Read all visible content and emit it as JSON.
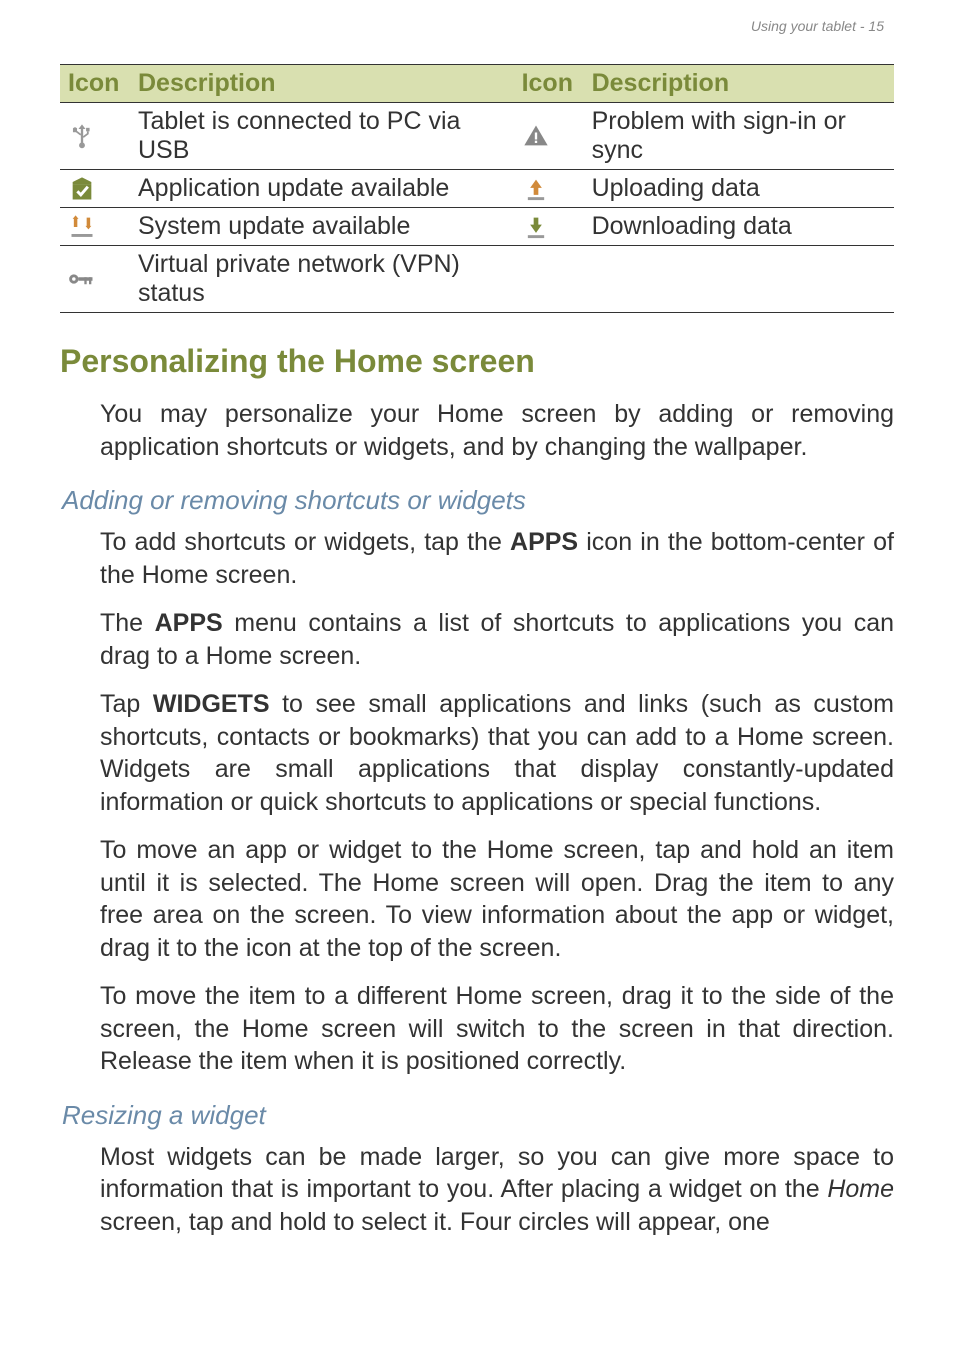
{
  "header": {
    "breadcrumb": "Using your tablet - 15"
  },
  "table": {
    "headers": {
      "icon1": "Icon",
      "desc1": "Description",
      "icon2": "Icon",
      "desc2": "Description"
    },
    "rows": [
      {
        "desc1": "Tablet is connected to PC via USB",
        "desc2": "Problem with sign-in or sync"
      },
      {
        "desc1": "Application update available",
        "desc2": "Uploading data"
      },
      {
        "desc1": "System update available",
        "desc2": "Downloading data"
      },
      {
        "desc1": "Virtual private network (VPN) status",
        "desc2": ""
      }
    ]
  },
  "section1": {
    "heading": "Personalizing the Home screen",
    "p1": "You may personalize your Home screen by adding or removing application shortcuts or widgets, and by changing the wallpaper."
  },
  "section2": {
    "heading": "Adding or removing shortcuts or widgets",
    "p1a": "To add shortcuts or widgets, tap the ",
    "p1b": "APPS",
    "p1c": " icon in the bottom-center of the Home screen.",
    "p2a": "The ",
    "p2b": "APPS",
    "p2c": " menu contains a list of shortcuts to applications you can drag to a Home screen.",
    "p3a": "Tap ",
    "p3b": "WIDGETS",
    "p3c": " to see small applications and links (such as custom shortcuts, contacts or bookmarks) that you can add to a Home screen. Widgets are small applications that display constantly-updated information or quick shortcuts to applications or special functions.",
    "p4": "To move an app or widget to the Home screen, tap and hold an item until it is selected. The Home screen will open. Drag the item to any free area on the screen. To view information about the app or widget, drag it to the icon at the top of the screen.",
    "p5": "To move the item to a different Home screen, drag it to the side of the screen, the Home screen will switch to the screen in that direction. Release the item when it is positioned correctly."
  },
  "section3": {
    "heading": "Resizing a widget",
    "p1a": "Most widgets can be made larger, so you can give more space to information that is important to you. After placing a widget on the ",
    "p1b": "Home",
    "p1c": " screen, tap and hold to select it. Four circles will appear, one"
  }
}
